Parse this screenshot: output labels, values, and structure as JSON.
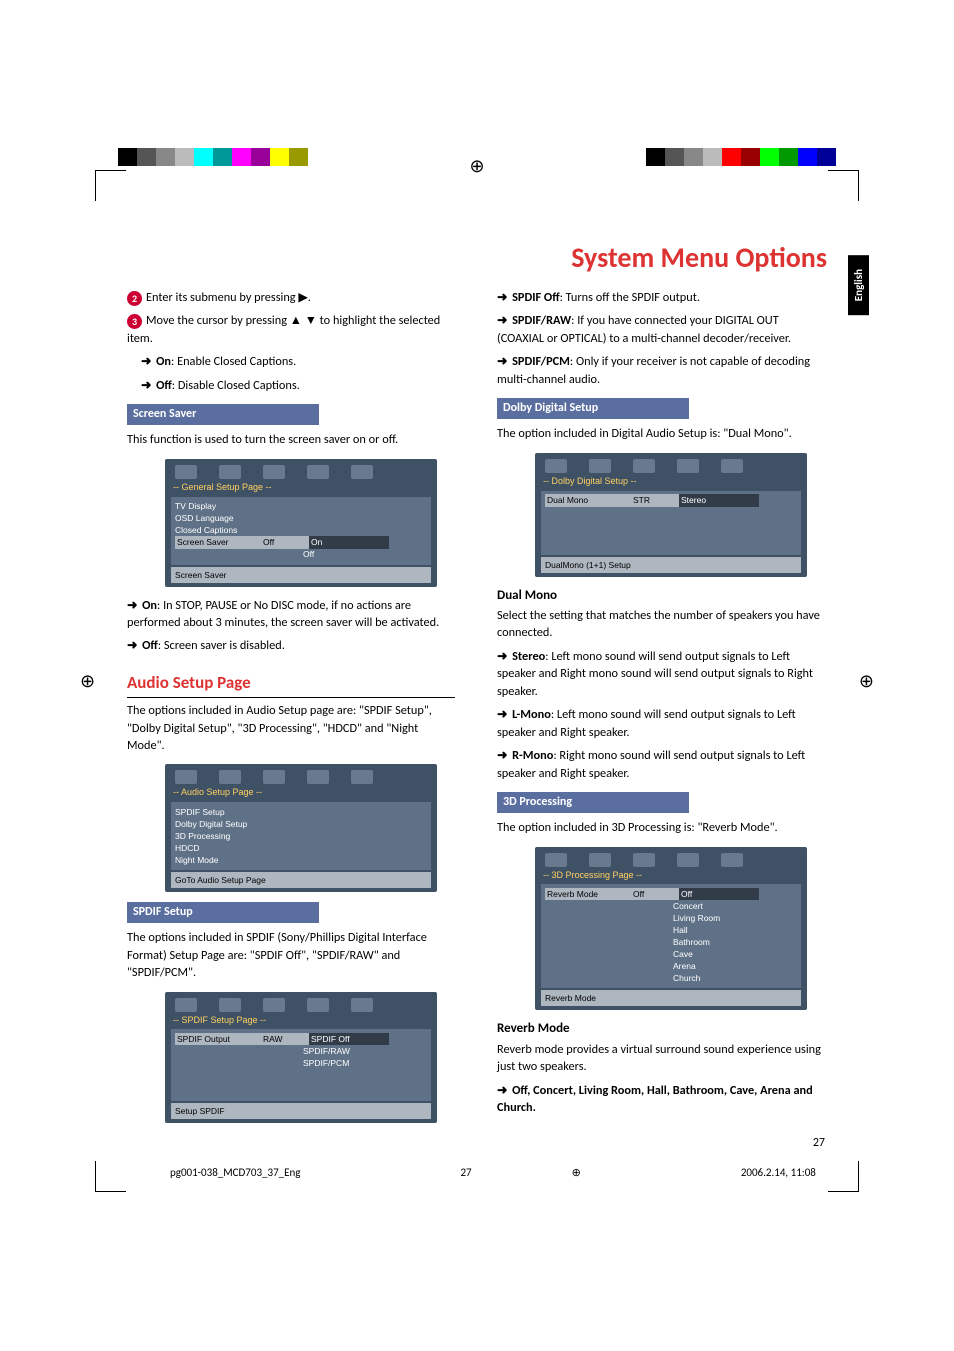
{
  "page": {
    "title": "System Menu Options",
    "language_tab": "English",
    "page_number": "27"
  },
  "footer": {
    "doc_id": "pg001-038_MCD703_37_Eng",
    "page": "27",
    "timestamp": "2006.2.14, 11:08"
  },
  "left": {
    "step2": "Enter its submenu by pressing ▶.",
    "step3": "Move the cursor by pressing ▲ ▼ to highlight the selected item.",
    "on_text": ": Enable Closed Captions.",
    "off_text": ": Disable Closed Captions.",
    "screen_saver_head": "Screen Saver",
    "screen_saver_body": "This function is used to turn the screen saver on or off.",
    "ss_on": ": In STOP, PAUSE or No DISC mode, if no actions are performed about 3 minutes, the screen saver will be activated.",
    "ss_off": ": Screen saver is disabled.",
    "audio_head": "Audio Setup Page",
    "audio_body": "The options included in Audio Setup page are: \"SPDIF Setup\", \"Dolby Digital Setup\", \"3D Processing\", \"HDCD\" and \"Night Mode\".",
    "spdif_head": "SPDIF Setup",
    "spdif_body": "The options included in SPDIF (Sony/Phillips Digital Interface Format) Setup Page are: \"SPDIF Off\", \"SPDIF/RAW\" and \"SPDIF/PCM\".",
    "osd_general": {
      "title": "-- General Setup Page --",
      "items": [
        "TV Display",
        "OSD Language",
        "Closed Captions"
      ],
      "sel_label": "Screen Saver",
      "sel_value": "Off",
      "opts": [
        "On",
        "Off"
      ],
      "footer": "Screen Saver"
    },
    "osd_audio": {
      "title": "-- Audio Setup Page --",
      "items": [
        "SPDIF Setup",
        "Dolby Digital Setup",
        "3D Processing",
        "HDCD",
        "Night Mode"
      ],
      "footer": "GoTo Audio Setup Page"
    },
    "osd_spdif": {
      "title": "-- SPDIF Setup Page --",
      "sel_label": "SPDIF Output",
      "sel_value": "RAW",
      "opts": [
        "SPDIF Off",
        "SPDIF/RAW",
        "SPDIF/PCM"
      ],
      "footer": "Setup SPDIF"
    }
  },
  "right": {
    "spdif_off": ": Turns off the SPDIF output.",
    "spdif_raw": ": If you have connected your DIGITAL OUT (COAXIAL or OPTICAL) to a multi-channel decoder/receiver.",
    "spdif_pcm": ": Only if your receiver is not capable of decoding multi-channel audio.",
    "dolby_head": "Dolby Digital Setup",
    "dolby_body": "The option included in Digital Audio Setup is: \"Dual Mono\".",
    "dual_head": "Dual Mono",
    "dual_body": "Select the setting that matches the number of speakers you have connected.",
    "stereo": ": Left mono sound will send output signals to Left speaker and Right mono sound will send output signals to Right speaker.",
    "lmono": ": Left mono sound will send output signals to Left speaker and Right speaker.",
    "rmono": ": Right mono sound will send output signals to Left speaker and Right speaker.",
    "threed_head": "3D Processing",
    "threed_body": "The option included in 3D Processing is: \"Reverb Mode\".",
    "reverb_head": "Reverb Mode",
    "reverb_body": "Reverb mode provides a virtual surround sound experience using just two speakers.",
    "reverb_opts_line": ", Concert, Living Room, Hall, Bathroom, Cave, Arena and Church.",
    "osd_dolby": {
      "title": "-- Dolby Digital Setup --",
      "sel_label": "Dual Mono",
      "sel_value": "STR",
      "opt": "Stereo",
      "footer": "DualMono (1+1) Setup"
    },
    "osd_3d": {
      "title": "-- 3D Processing Page --",
      "sel_label": "Reverb Mode",
      "sel_value": "Off",
      "opts": [
        "Off",
        "Concert",
        "Living Room",
        "Hall",
        "Bathroom",
        "Cave",
        "Arena",
        "Church"
      ],
      "footer": "Reverb Mode"
    }
  },
  "labels": {
    "on": "On",
    "off": "Off",
    "spdif_off_l": "SPDIF Off",
    "spdif_raw_l": "SPDIF/RAW",
    "spdif_pcm_l": "SPDIF/PCM",
    "stereo_l": "Stereo",
    "lmono_l": "L-Mono",
    "rmono_l": "R-Mono"
  }
}
